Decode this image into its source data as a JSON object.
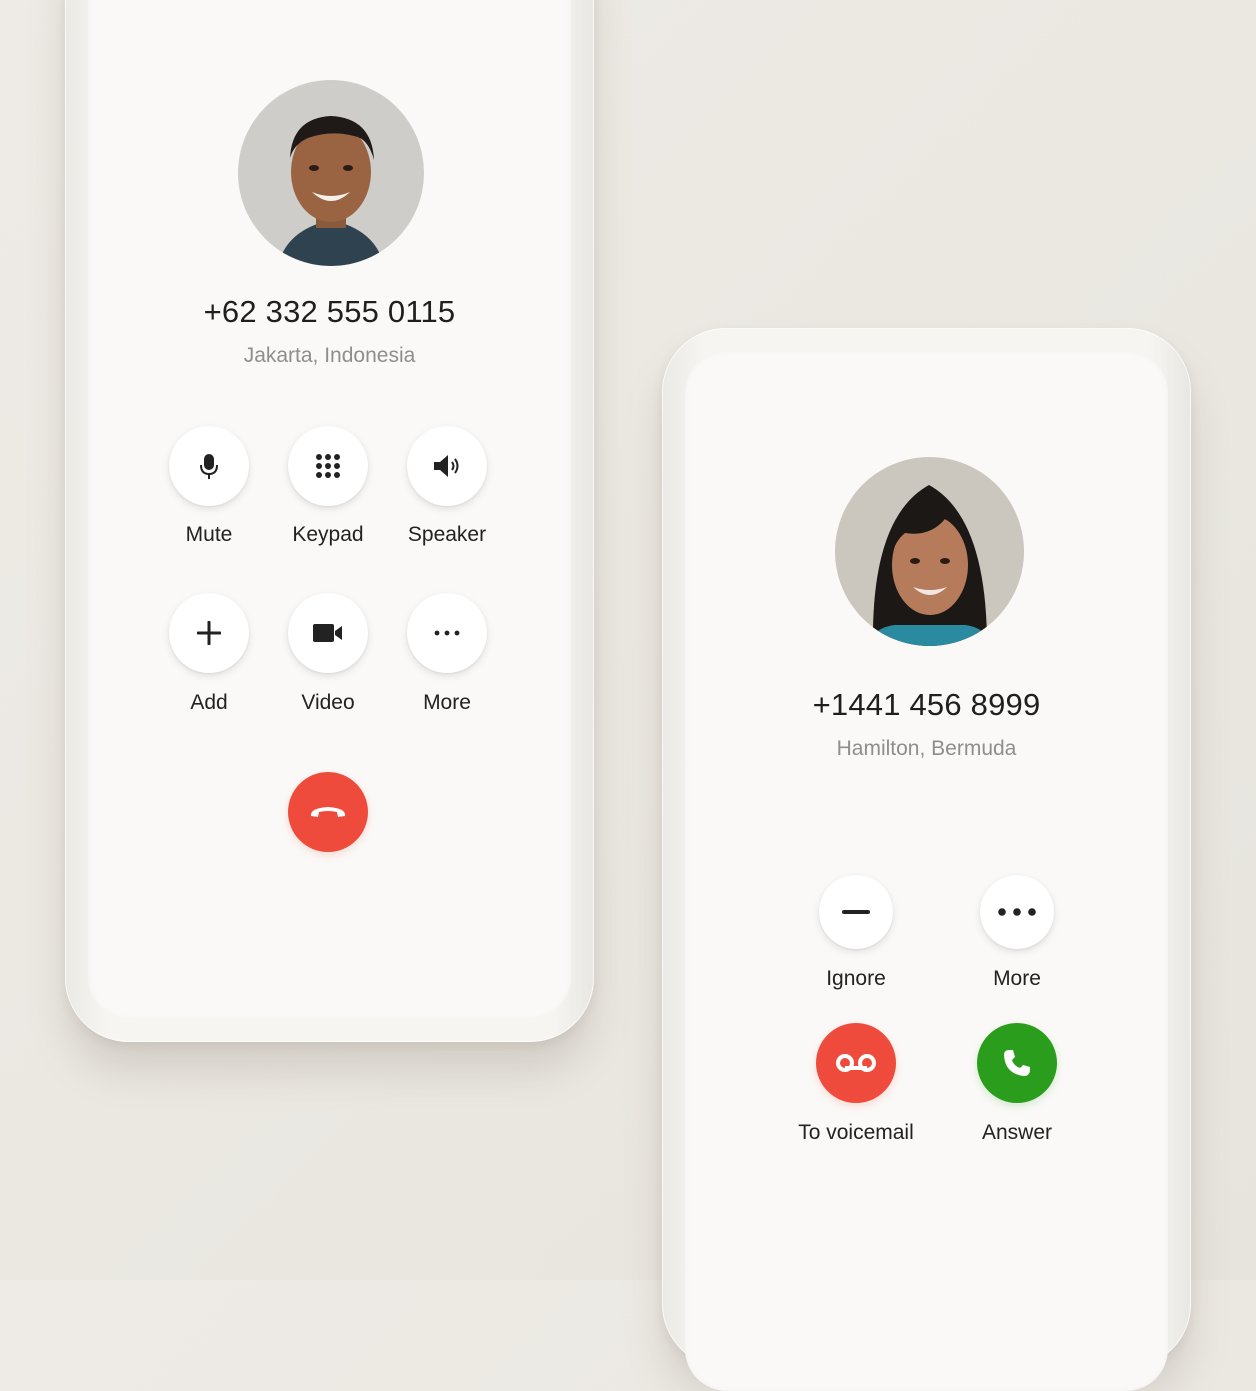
{
  "active_call": {
    "phone_number": "+62 332 555 0115",
    "location": "Jakarta, Indonesia",
    "avatar_icon": "contact-photo-man",
    "controls": [
      {
        "label": "Mute",
        "icon": "microphone-icon"
      },
      {
        "label": "Keypad",
        "icon": "keypad-icon"
      },
      {
        "label": "Speaker",
        "icon": "speaker-icon"
      },
      {
        "label": "Add",
        "icon": "plus-icon"
      },
      {
        "label": "Video",
        "icon": "video-camera-icon"
      },
      {
        "label": "More",
        "icon": "more-icon"
      }
    ],
    "end_call_icon": "hang-up-icon"
  },
  "incoming_call": {
    "phone_number": "+1441 456 8999",
    "location": "Hamilton, Bermuda",
    "avatar_icon": "contact-photo-woman",
    "actions": [
      {
        "label": "Ignore",
        "icon": "minus-icon"
      },
      {
        "label": "More",
        "icon": "more-icon"
      },
      {
        "label": "To voicemail",
        "icon": "voicemail-icon"
      },
      {
        "label": "Answer",
        "icon": "phone-answer-icon"
      }
    ]
  },
  "colors": {
    "decline": "#ee4b3c",
    "accept": "#2a9d1c",
    "background": "#ece9e4",
    "text_primary": "#1f1f1f",
    "text_secondary": "#8e8e8e"
  }
}
